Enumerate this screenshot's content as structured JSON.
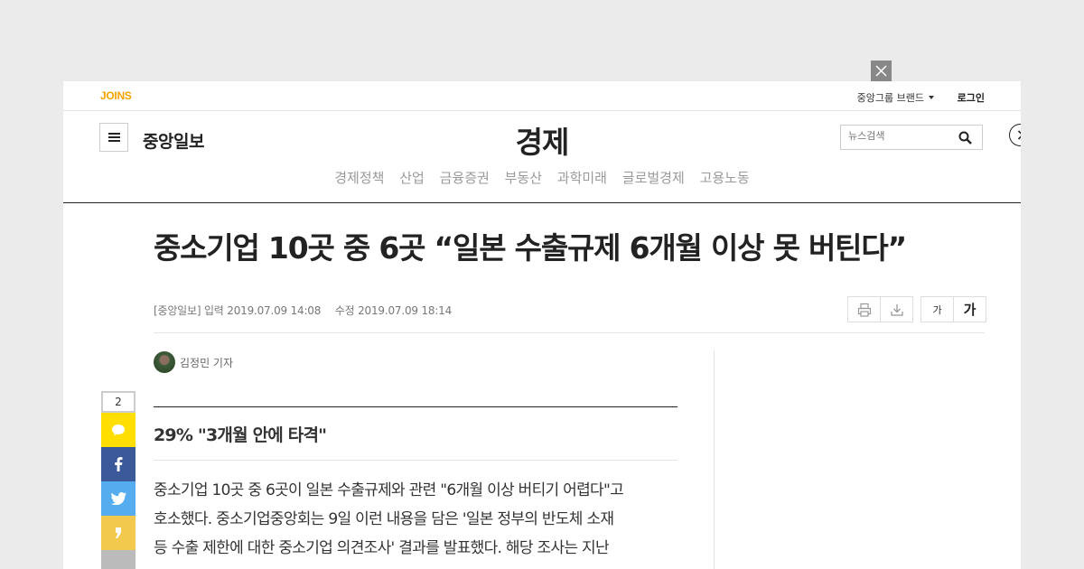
{
  "top_bar": {
    "logo": "JOINS",
    "group_brand_label": "중앙그룹 브랜드",
    "login_label": "로그인"
  },
  "header": {
    "brand": "중앙일보",
    "section_title": "경제",
    "search_placeholder": "뉴스검색"
  },
  "nav": {
    "items": [
      "경제정책",
      "산업",
      "금융증권",
      "부동산",
      "과학미래",
      "글로벌경제",
      "고용노동"
    ]
  },
  "article": {
    "headline": "중소기업 10곳 중 6곳 “일본 수출규제 6개월 이상 못 버틴다”",
    "source": "[중앙일보]",
    "input_label": "입력",
    "input_time": "2019.07.09 14:08",
    "modified_label": "수정",
    "modified_time": "2019.07.09 18:14",
    "font_small_label": "가",
    "font_large_label": "가",
    "author": "김정민 기자",
    "subhead": "29% \"3개월 안에 타격\"",
    "body_lines": [
      "중소기업 10곳 중 6곳이 일본 수출규제와 관련 \"6개월 이상 버티기 어렵다\"고",
      "호소했다. 중소기업중앙회는 9일 이런 내용을 담은 '일본 정부의 반도체 소재",
      "등 수출 제한에 대한 중소기업 의견조사' 결과를 발표했다. 해당 조사는 지난"
    ]
  },
  "share": {
    "count": "2",
    "colors": {
      "kakao": "#ffde00",
      "facebook": "#3b5998",
      "twitter": "#55acee",
      "kakaostory": "#f2c94c",
      "more": "#bbbbbb"
    }
  },
  "icons": [
    "close-icon",
    "menu-icon",
    "search-icon",
    "chevron-right-icon",
    "print-icon",
    "download-icon",
    "speech-bubble-icon",
    "facebook-icon",
    "twitter-icon",
    "story-icon"
  ]
}
